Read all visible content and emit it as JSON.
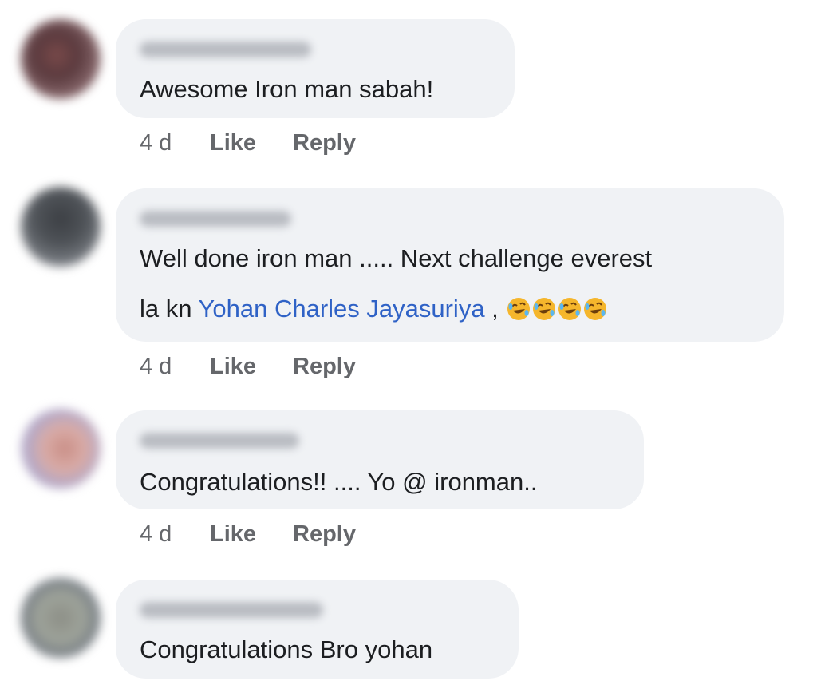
{
  "comments": [
    {
      "text": "Awesome Iron man sabah!",
      "time": "4 d",
      "like_label": "Like",
      "reply_label": "Reply"
    },
    {
      "text_line1": "Well done iron man ..... Next challenge everest",
      "text_line2_prefix": "la kn ",
      "mention": "Yohan Charles Jayasuriya",
      "text_line2_suffix": " ,",
      "emojis": [
        "rolling-on-floor-laughing",
        "rolling-on-floor-laughing",
        "rolling-on-floor-laughing",
        "rolling-on-floor-laughing"
      ],
      "time": "4 d",
      "like_label": "Like",
      "reply_label": "Reply"
    },
    {
      "text": "Congratulations!! .... Yo @ ironman..",
      "time": "4 d",
      "like_label": "Like",
      "reply_label": "Reply"
    },
    {
      "text": "Congratulations Bro yohan"
    }
  ],
  "colors": {
    "bubble": "#f0f2f5",
    "mention": "#2f62c6",
    "meta": "#65676b",
    "text": "#1c1e21"
  }
}
